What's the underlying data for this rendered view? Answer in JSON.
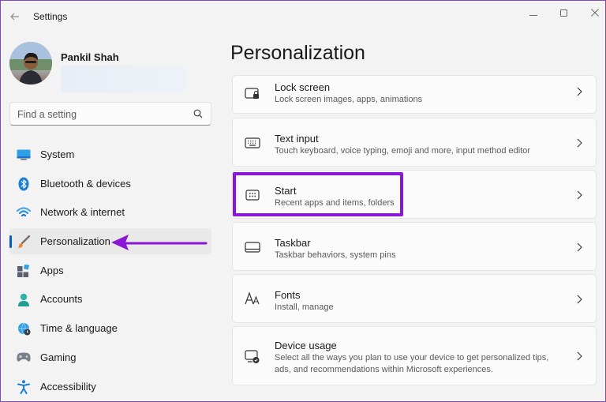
{
  "window": {
    "title": "Settings"
  },
  "profile": {
    "name": "Pankil Shah"
  },
  "search": {
    "placeholder": "Find a setting"
  },
  "sidebar": {
    "items": [
      {
        "label": "System",
        "icon": "monitor-icon"
      },
      {
        "label": "Bluetooth & devices",
        "icon": "bluetooth-icon"
      },
      {
        "label": "Network & internet",
        "icon": "wifi-icon"
      },
      {
        "label": "Personalization",
        "icon": "brush-icon",
        "active": true
      },
      {
        "label": "Apps",
        "icon": "apps-icon"
      },
      {
        "label": "Accounts",
        "icon": "person-icon"
      },
      {
        "label": "Time & language",
        "icon": "globe-clock-icon"
      },
      {
        "label": "Gaming",
        "icon": "gamepad-icon"
      },
      {
        "label": "Accessibility",
        "icon": "accessibility-icon"
      }
    ]
  },
  "main": {
    "title": "Personalization",
    "cards": [
      {
        "title": "Lock screen",
        "desc": "Lock screen images, apps, animations",
        "icon": "lock-screen-icon"
      },
      {
        "title": "Text input",
        "desc": "Touch keyboard, voice typing, emoji and more, input method editor",
        "icon": "keyboard-icon"
      },
      {
        "title": "Start",
        "desc": "Recent apps and items, folders",
        "icon": "start-icon"
      },
      {
        "title": "Taskbar",
        "desc": "Taskbar behaviors, system pins",
        "icon": "taskbar-icon"
      },
      {
        "title": "Fonts",
        "desc": "Install, manage",
        "icon": "fonts-icon"
      },
      {
        "title": "Device usage",
        "desc": "Select all the ways you plan to use your device to get personalized tips, ads, and recommendations within Microsoft experiences.",
        "icon": "device-usage-icon"
      }
    ]
  },
  "colors": {
    "accent": "#005fb8",
    "annotation": "#8a17d6"
  }
}
